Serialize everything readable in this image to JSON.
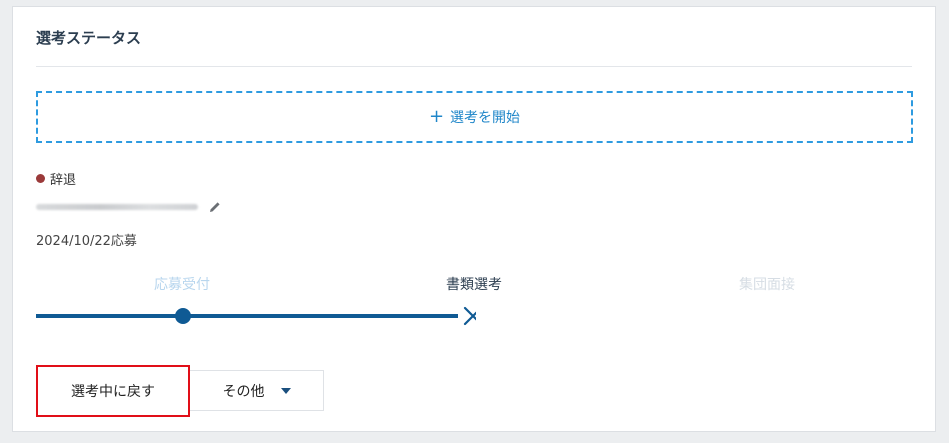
{
  "card": {
    "title": "選考ステータス"
  },
  "start_button": {
    "icon": "+",
    "label": "選考を開始"
  },
  "status": {
    "label": "辞退",
    "dot_color": "#9b3a3a"
  },
  "applicant": {
    "applied_date": "2024/10/22応募"
  },
  "stages": [
    {
      "label": "応募受付",
      "state": "done"
    },
    {
      "label": "書類選考",
      "state": "current"
    },
    {
      "label": "集団面接",
      "state": "future"
    }
  ],
  "progress": {
    "accent_color": "#0f5a94",
    "end_marker": "×"
  },
  "actions": {
    "back_label": "選考中に戻す",
    "other_label": "その他"
  }
}
